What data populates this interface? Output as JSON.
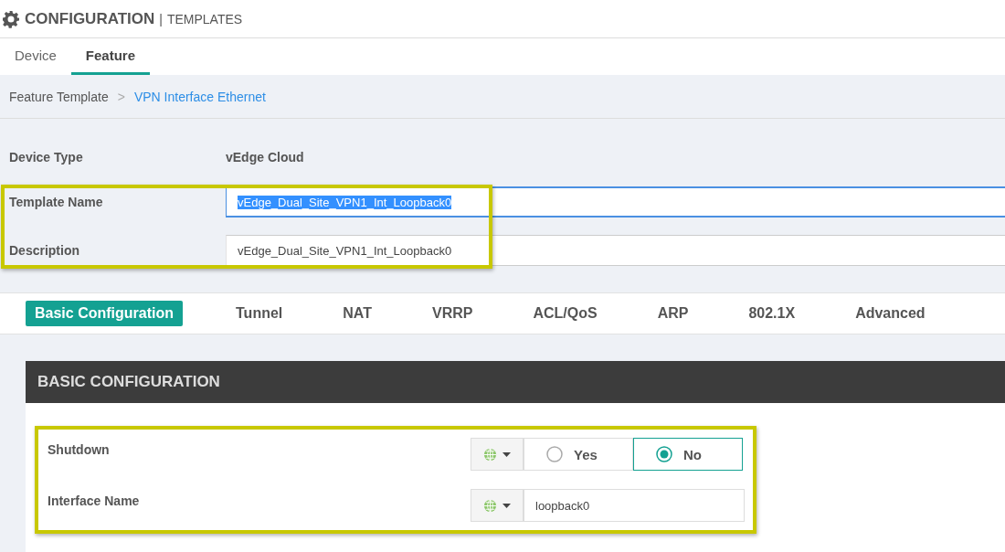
{
  "header": {
    "title": "CONFIGURATION",
    "divider": "|",
    "subtitle": "TEMPLATES"
  },
  "tabs": [
    {
      "label": "Device",
      "selected": false
    },
    {
      "label": "Feature",
      "selected": true
    }
  ],
  "breadcrumb": {
    "parent": "Feature Template",
    "separator": ">",
    "current": "VPN Interface Ethernet"
  },
  "form": [
    {
      "kind": "text",
      "label": "Device Type",
      "value": "vEdge Cloud"
    },
    {
      "kind": "input",
      "label": "Template Name",
      "value": "vEdge_Dual_Site_VPN1_Int_Loopback0",
      "focused": true,
      "text_selected": true
    },
    {
      "kind": "input",
      "label": "Description",
      "value": "vEdge_Dual_Site_VPN1_Int_Loopback0",
      "focused": false,
      "text_selected": false
    }
  ],
  "section_tabs": [
    {
      "label": "Basic Configuration",
      "selected": true
    },
    {
      "label": "Tunnel",
      "selected": false
    },
    {
      "label": "NAT",
      "selected": false
    },
    {
      "label": "VRRP",
      "selected": false
    },
    {
      "label": "ACL/QoS",
      "selected": false
    },
    {
      "label": "ARP",
      "selected": false
    },
    {
      "label": "802.1X",
      "selected": false
    },
    {
      "label": "Advanced",
      "selected": false
    }
  ],
  "panel": {
    "title": "BASIC CONFIGURATION",
    "fields": [
      {
        "kind": "radio",
        "label": "Shutdown",
        "options": [
          {
            "label": "Yes",
            "selected": false
          },
          {
            "label": "No",
            "selected": true
          }
        ]
      },
      {
        "kind": "input",
        "label": "Interface Name",
        "value": "loopback0"
      }
    ]
  }
}
